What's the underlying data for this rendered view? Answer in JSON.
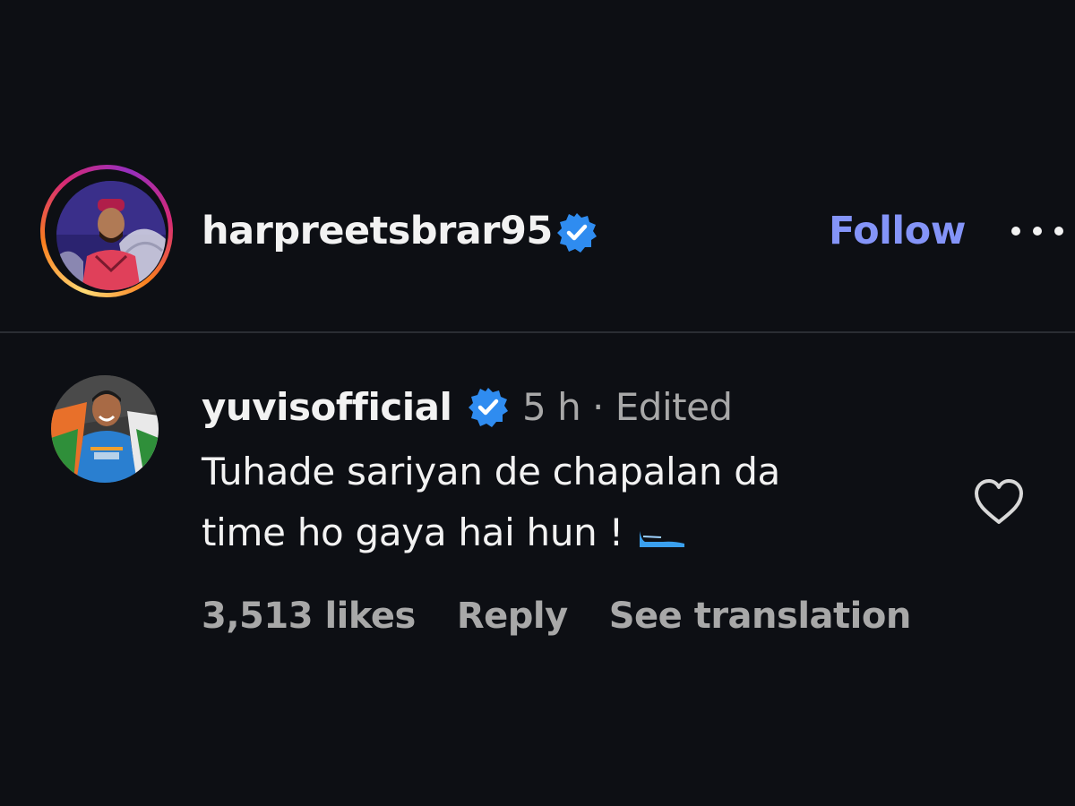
{
  "post": {
    "author": {
      "username": "harpreetsbrar95",
      "verified": true
    },
    "follow_label": "Follow",
    "more_icon": "more-horizontal-icon"
  },
  "comment": {
    "author": {
      "username": "yuvisofficial",
      "verified": true
    },
    "time_meta": "5 h · Edited",
    "text_lines": [
      "Tuhade sariyan de chapalan da",
      "time ho gaya hai hun !"
    ],
    "likes": "3,513 likes",
    "reply_label": "Reply",
    "translate_label": "See translation",
    "like_icon": "heart-outline-icon"
  },
  "colors": {
    "background": "#0d0f14",
    "text_primary": "#f2f2f2",
    "text_secondary": "#a8a8a8",
    "follow_blue": "#8494f8",
    "verified_blue": "#2f8cf0",
    "divider": "#2a2d33"
  }
}
